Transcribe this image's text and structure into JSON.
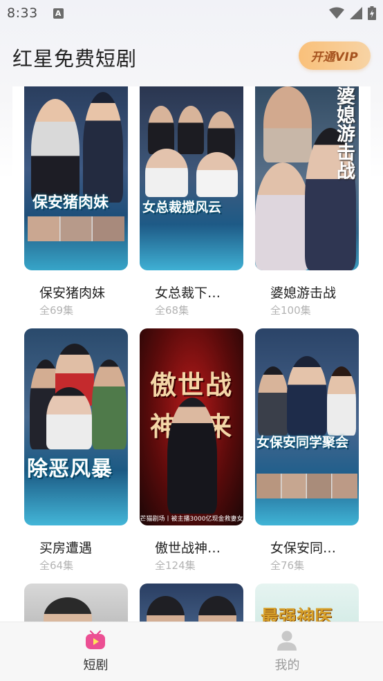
{
  "status_bar": {
    "time": "8:33",
    "notification_badge": "A"
  },
  "header": {
    "title": "红星免费短剧",
    "vip_label": "开通VIP"
  },
  "dramas": [
    {
      "title": "保安猪肉妹",
      "count": "全69集",
      "poster_text": "保安猪肉妹"
    },
    {
      "title": "女总裁下…",
      "count": "全68集",
      "poster_text": "女总裁搅风云"
    },
    {
      "title": "婆媳游击战",
      "count": "全100集",
      "poster_text": "婆媳游击战"
    },
    {
      "title": "买房遭遇",
      "count": "全64集",
      "poster_text": "除恶风暴"
    },
    {
      "title": "傲世战神…",
      "count": "全124集",
      "poster_text": "傲世战神归来",
      "poster_subtext": "芒猫剧场丨被主播3000亿现金救妻女"
    },
    {
      "title": "女保安同…",
      "count": "全76集",
      "poster_text": "女保安同学聚会"
    },
    {
      "title": "",
      "count": "",
      "poster_text": ""
    },
    {
      "title": "",
      "count": "",
      "poster_text": ""
    },
    {
      "title": "",
      "count": "",
      "poster_text": "最强神医"
    }
  ],
  "tabbar": {
    "tabs": [
      {
        "label": "短剧",
        "active": true,
        "color": "#333333"
      },
      {
        "label": "我的",
        "active": false,
        "color": "#9a9a9a"
      }
    ]
  },
  "colors": {
    "accent": "#e8458b",
    "vip_bg": "#f9c07a",
    "vip_text": "#a5521e"
  }
}
